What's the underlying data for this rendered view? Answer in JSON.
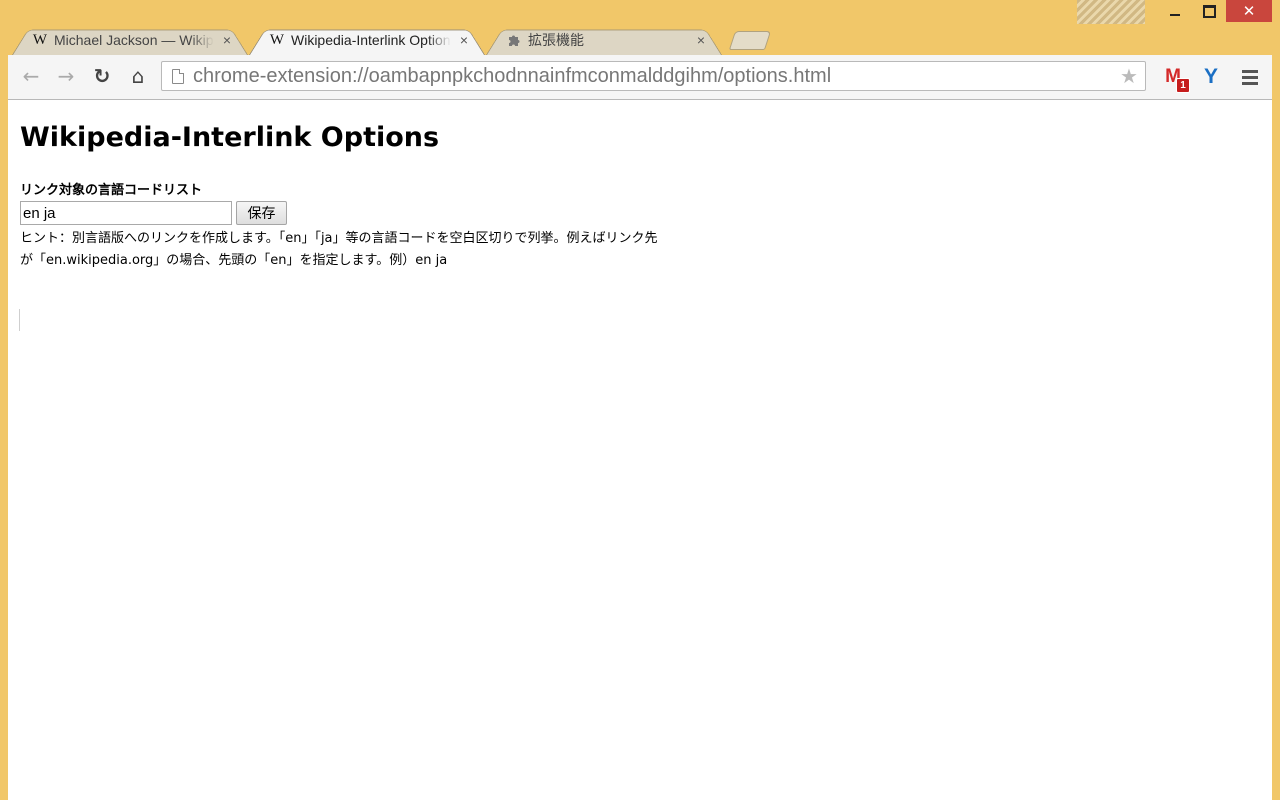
{
  "window": {
    "minimize_icon": "minimize-icon",
    "maximize_icon": "maximize-icon",
    "close_glyph": "✕"
  },
  "tabs": [
    {
      "favicon": "W",
      "title": "Michael Jackson — Wikipedia",
      "close": "×",
      "active": false
    },
    {
      "favicon": "W",
      "title": "Wikipedia-Interlink Options",
      "close": "×",
      "active": true
    },
    {
      "favicon": "puzzle-icon",
      "title": "拡張機能",
      "close": "×",
      "active": false
    }
  ],
  "toolbar": {
    "back_glyph": "←",
    "forward_glyph": "→",
    "reload_glyph": "↻",
    "home_glyph": "⌂",
    "url": "chrome-extension://oambapnpkchodnnainfmconmalddgihm/options.html",
    "star_glyph": "★",
    "gmail_letter": "M",
    "gmail_badge": "1",
    "y_letter": "Y"
  },
  "page": {
    "title": "Wikipedia-Interlink Options",
    "field_label": "リンク対象の言語コードリスト",
    "input_value": "en ja",
    "save_label": "保存",
    "hint_line1": "ヒント：別言語版へのリンクを作成します。「en」「ja」等の言語コードを空白区切りで列挙。例えばリンク先",
    "hint_line2": "が「en.wikipedia.org」の場合、先頭の「en」を指定します。例）en ja"
  },
  "colors": {
    "frame": "#f1c769",
    "close_button": "#c9463d",
    "gmail_red": "#d42a2a",
    "accent_blue": "#1b6fc4"
  }
}
